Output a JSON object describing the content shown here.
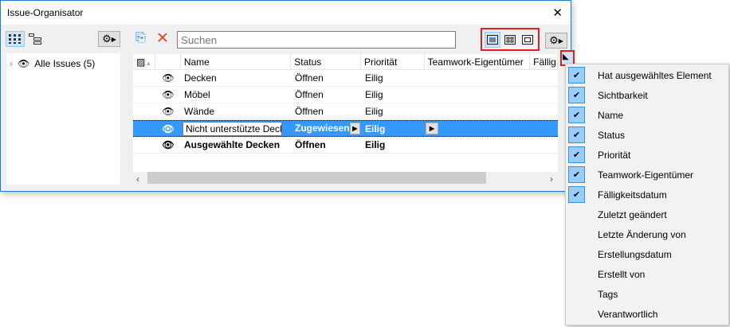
{
  "window": {
    "title": "Issue-Organisator",
    "close": "✕"
  },
  "left": {
    "tree_item": "Alle Issues (5)"
  },
  "toolbar": {
    "search_placeholder": "Suchen"
  },
  "table": {
    "headers": [
      "Name",
      "Status",
      "Priorität",
      "Teamwork-Eigentümer",
      "Fällig"
    ],
    "rows": [
      {
        "name": "Decken",
        "status": "Öffnen",
        "priority": "Eilig"
      },
      {
        "name": "Möbel",
        "status": "Öffnen",
        "priority": "Eilig"
      },
      {
        "name": "Wände",
        "status": "Öffnen",
        "priority": "Eilig"
      },
      {
        "name": "Nicht unterstützte Decke",
        "status": "Zugewiesen",
        "priority": "Eilig"
      },
      {
        "name": "Ausgewählte Decken",
        "status": "Öffnen",
        "priority": "Eilig"
      }
    ]
  },
  "menu": {
    "items": [
      {
        "label": "Hat ausgewähltes Element",
        "checked": true
      },
      {
        "label": "Sichtbarkeit",
        "checked": true
      },
      {
        "label": "Name",
        "checked": true
      },
      {
        "label": "Status",
        "checked": true
      },
      {
        "label": "Priorität",
        "checked": true
      },
      {
        "label": "Teamwork-Eigentümer",
        "checked": true
      },
      {
        "label": "Fälligkeitsdatum",
        "checked": true
      },
      {
        "label": "Zuletzt geändert",
        "checked": false
      },
      {
        "label": "Letzte Änderung von",
        "checked": false
      },
      {
        "label": "Erstellungsdatum",
        "checked": false
      },
      {
        "label": "Erstellt von",
        "checked": false
      },
      {
        "label": "Tags",
        "checked": false
      },
      {
        "label": "Verantwortlich",
        "checked": false
      }
    ]
  }
}
